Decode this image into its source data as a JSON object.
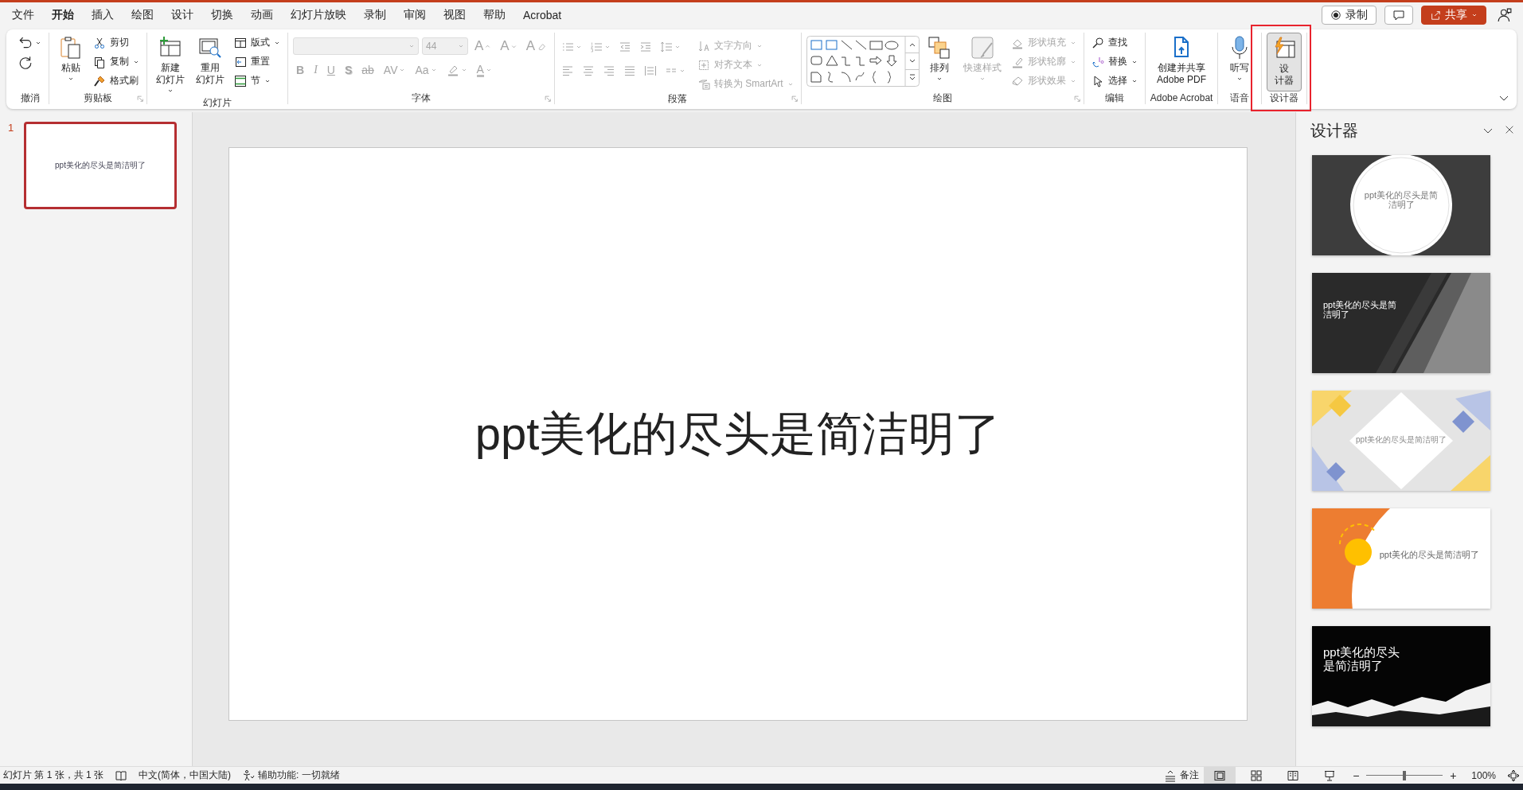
{
  "menu_tabs": [
    {
      "label": "文件",
      "selected": false
    },
    {
      "label": "开始",
      "selected": true
    },
    {
      "label": "插入",
      "selected": false
    },
    {
      "label": "绘图",
      "selected": false
    },
    {
      "label": "设计",
      "selected": false
    },
    {
      "label": "切换",
      "selected": false
    },
    {
      "label": "动画",
      "selected": false
    },
    {
      "label": "幻灯片放映",
      "selected": false
    },
    {
      "label": "录制",
      "selected": false
    },
    {
      "label": "审阅",
      "selected": false
    },
    {
      "label": "视图",
      "selected": false
    },
    {
      "label": "帮助",
      "selected": false
    },
    {
      "label": "Acrobat",
      "selected": false
    }
  ],
  "header_buttons": [
    {
      "kind": "record",
      "label": "录制"
    },
    {
      "kind": "comments"
    },
    {
      "kind": "share",
      "label": "共享"
    },
    {
      "kind": "coauthor"
    }
  ],
  "ribbon": {
    "groups": [
      {
        "kind": "buttons",
        "label": "撤消",
        "launcher": false,
        "highlighted": false,
        "items": [
          {
            "kind": "icon",
            "dropdown": true,
            "disabled": false
          },
          {
            "kind": "icon",
            "dropdown": false,
            "disabled": false
          }
        ]
      },
      {
        "kind": "buttons",
        "label": "剪贴板",
        "launcher": true,
        "highlighted": false,
        "items": [
          {
            "kind": "large",
            "lines": [
              "粘贴"
            ],
            "dropdown": true,
            "disabled": false
          },
          {
            "kind": "small",
            "label": "剪切",
            "dropdown": false,
            "disabled": false
          },
          {
            "kind": "small",
            "label": "复制",
            "dropdown": true,
            "disabled": false
          },
          {
            "kind": "small",
            "label": "格式刷",
            "dropdown": false,
            "disabled": false
          }
        ]
      },
      {
        "kind": "buttons",
        "label": "幻灯片",
        "launcher": false,
        "highlighted": false,
        "items": [
          {
            "kind": "large",
            "lines": [
              "新建",
              "幻灯片"
            ],
            "dropdown": true,
            "disabled": false
          },
          {
            "kind": "large",
            "lines": [
              "重用",
              "幻灯片"
            ],
            "dropdown": false,
            "disabled": false
          },
          {
            "kind": "small",
            "label": "版式",
            "dropdown": true,
            "disabled": false
          },
          {
            "kind": "small",
            "label": "重置",
            "dropdown": false,
            "disabled": false
          },
          {
            "kind": "small",
            "label": "节",
            "dropdown": true,
            "disabled": false
          }
        ]
      },
      {
        "kind": "font",
        "label": "字体",
        "launcher": true,
        "highlighted": false,
        "disabled": true,
        "size": "44",
        "top_buttons": [
          {
            "kind": "grow",
            "glyph": "A"
          },
          {
            "kind": "shrink",
            "glyph": "A"
          },
          {
            "kind": "clear",
            "glyph": "A"
          }
        ],
        "format_buttons": [
          {
            "kind": "bold",
            "glyph": "B",
            "dropdown": false
          },
          {
            "kind": "italic",
            "glyph": "I",
            "dropdown": false
          },
          {
            "kind": "underline",
            "glyph": "U",
            "dropdown": false
          },
          {
            "kind": "shadow",
            "glyph": "S",
            "dropdown": false
          },
          {
            "kind": "strike",
            "glyph": "ab",
            "dropdown": false
          },
          {
            "kind": "spacing",
            "glyph": "AV",
            "dropdown": true
          },
          {
            "kind": "case",
            "glyph": "Aa",
            "dropdown": true
          },
          {
            "kind": "highlight",
            "dropdown": true
          },
          {
            "kind": "color",
            "glyph": "A",
            "dropdown": true
          }
        ]
      },
      {
        "kind": "paragraph",
        "label": "段落",
        "launcher": true,
        "highlighted": false,
        "disabled": true,
        "icon_rows": [
          [
            {
              "dropdown": true
            },
            {
              "dropdown": true
            },
            {
              "dropdown": false
            },
            {
              "dropdown": false
            },
            {
              "dropdown": true
            }
          ],
          [
            {
              "dropdown": false
            },
            {
              "dropdown": false
            },
            {
              "dropdown": false
            },
            {
              "dropdown": false
            },
            {
              "dropdown": false
            },
            {
              "dropdown": true
            }
          ]
        ],
        "items": [
          {
            "kind": "small",
            "label": "文字方向",
            "dropdown": true,
            "disabled": true
          },
          {
            "kind": "small",
            "label": "对齐文本",
            "dropdown": true,
            "disabled": true
          },
          {
            "kind": "small",
            "label": "转换为 SmartArt",
            "dropdown": true,
            "disabled": true
          }
        ]
      },
      {
        "kind": "buttons",
        "label": "绘图",
        "launcher": true,
        "highlighted": false,
        "gallery": true,
        "items": [
          {
            "kind": "large",
            "lines": [
              "排列"
            ],
            "dropdown": true,
            "disabled": false
          },
          {
            "kind": "large",
            "lines": [
              "快速样式"
            ],
            "dropdown": true,
            "disabled": true
          },
          {
            "kind": "small",
            "label": "形状填充",
            "dropdown": true,
            "disabled": true
          },
          {
            "kind": "small",
            "label": "形状轮廓",
            "dropdown": true,
            "disabled": true
          },
          {
            "kind": "small",
            "label": "形状效果",
            "dropdown": true,
            "disabled": true
          }
        ]
      },
      {
        "kind": "buttons",
        "label": "编辑",
        "launcher": false,
        "highlighted": false,
        "items": [
          {
            "kind": "small",
            "label": "查找",
            "dropdown": false,
            "disabled": false
          },
          {
            "kind": "small",
            "label": "替换",
            "dropdown": true,
            "disabled": false
          },
          {
            "kind": "small",
            "label": "选择",
            "dropdown": true,
            "disabled": false
          }
        ]
      },
      {
        "kind": "buttons",
        "label": "Adobe Acrobat",
        "launcher": false,
        "highlighted": false,
        "items": [
          {
            "kind": "large",
            "lines": [
              "创建并共享",
              "Adobe PDF"
            ],
            "dropdown": false,
            "disabled": false
          }
        ]
      },
      {
        "kind": "buttons",
        "label": "语音",
        "launcher": false,
        "highlighted": false,
        "items": [
          {
            "kind": "large",
            "lines": [
              "听写"
            ],
            "dropdown": true,
            "disabled": false
          }
        ]
      },
      {
        "kind": "buttons",
        "label": "设计器",
        "launcher": false,
        "highlighted": true,
        "items": [
          {
            "kind": "large",
            "lines": [
              "设",
              "计器"
            ],
            "dropdown": false,
            "disabled": false,
            "pressed": true
          }
        ]
      }
    ]
  },
  "thumbnails": [
    {
      "number": "1",
      "text": "ppt美化的尽头是简洁明了",
      "selected": true
    }
  ],
  "slide": {
    "title": "ppt美化的尽头是简洁明了"
  },
  "designer": {
    "title": "设计器",
    "designs": [
      {
        "kind": "circle",
        "text": "ppt美化的尽头是简洁明了"
      },
      {
        "kind": "diagonal",
        "text": "ppt美化的尽头是简洁明了"
      },
      {
        "kind": "diamonds",
        "text": "ppt美化的尽头是简洁明了"
      },
      {
        "kind": "sun",
        "text": "ppt美化的尽头是简洁明了"
      },
      {
        "kind": "torn",
        "text": "ppt美化的尽头是简洁明了"
      }
    ]
  },
  "status_bar": {
    "slide_info": "幻灯片 第 1 张，共 1 张",
    "language": "中文(简体，中国大陆)",
    "accessibility": "辅助功能: 一切就绪",
    "notes": "备注",
    "views": [
      {
        "selected": true
      },
      {
        "selected": false
      },
      {
        "selected": false
      },
      {
        "selected": false
      }
    ],
    "zoom": {
      "minus": "−",
      "plus": "+",
      "level": 0.5,
      "value": "100%"
    }
  }
}
